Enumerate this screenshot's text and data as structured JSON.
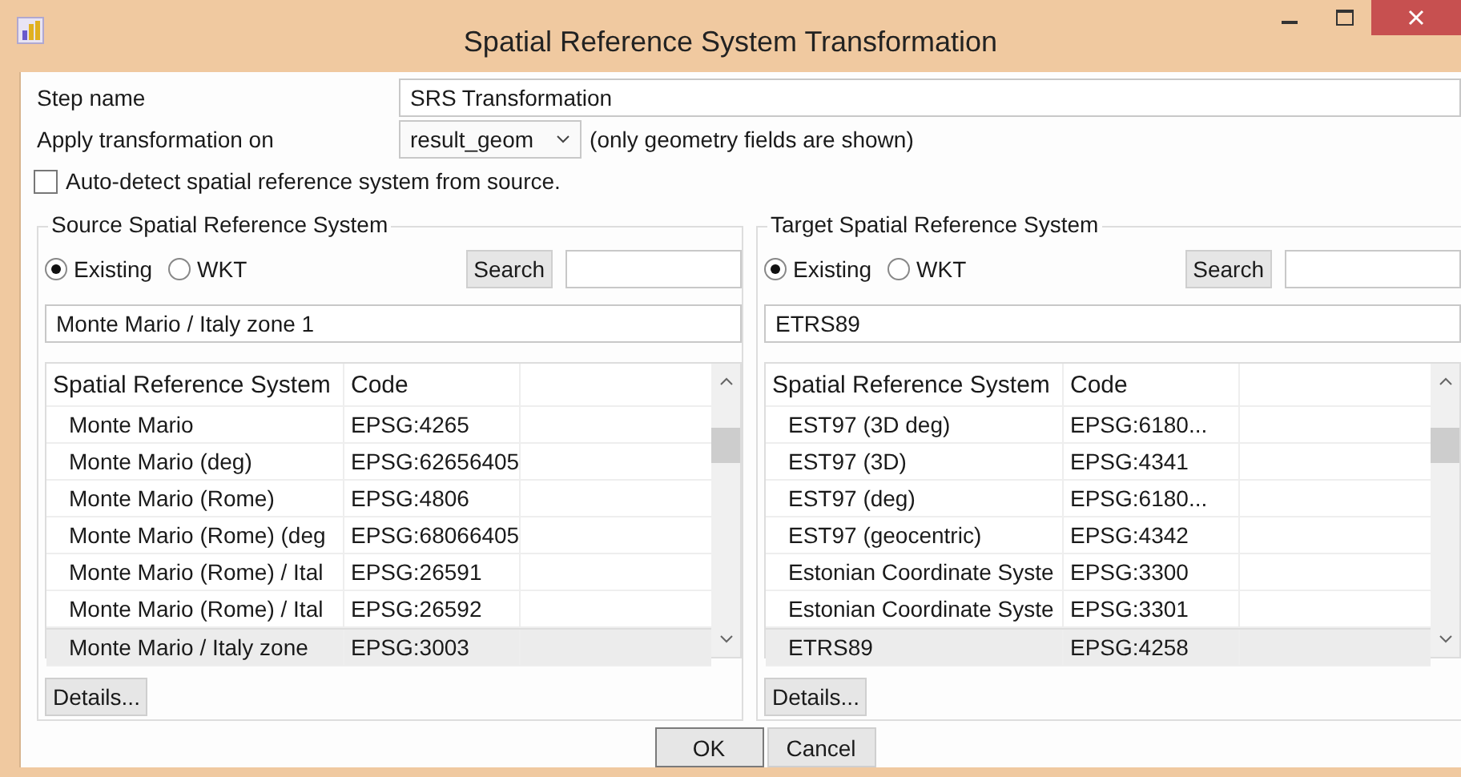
{
  "window": {
    "title": "Spatial Reference System Transformation"
  },
  "step_name": {
    "label": "Step name",
    "value": "SRS Transformation"
  },
  "apply_on": {
    "label": "Apply transformation on",
    "value": "result_geom",
    "note": "(only geometry fields are shown)"
  },
  "auto_detect": {
    "label": "Auto-detect spatial reference system from source.",
    "checked": false
  },
  "panels": [
    {
      "title": "Source Spatial Reference System",
      "radios": [
        {
          "label": "Existing",
          "selected": true
        },
        {
          "label": "WKT",
          "selected": false
        }
      ],
      "search_button": "Search",
      "current": "Monte Mario / Italy zone 1",
      "columns": [
        "Spatial Reference System",
        "Code"
      ],
      "rows": [
        {
          "name": "Monte Mario",
          "code": "EPSG:4265",
          "selected": false
        },
        {
          "name": "Monte Mario (deg)",
          "code": "EPSG:62656405",
          "selected": false
        },
        {
          "name": "Monte Mario (Rome)",
          "code": "EPSG:4806",
          "selected": false
        },
        {
          "name": "Monte Mario (Rome) (deg",
          "code": "EPSG:68066405",
          "selected": false
        },
        {
          "name": "Monte Mario (Rome) / Ital",
          "code": "EPSG:26591",
          "selected": false
        },
        {
          "name": "Monte Mario (Rome) / Ital",
          "code": "EPSG:26592",
          "selected": false
        },
        {
          "name": "Monte Mario / Italy zone",
          "code": "EPSG:3003",
          "selected": true
        }
      ],
      "details_button": "Details..."
    },
    {
      "title": "Target Spatial Reference System",
      "radios": [
        {
          "label": "Existing",
          "selected": true
        },
        {
          "label": "WKT",
          "selected": false
        }
      ],
      "search_button": "Search",
      "current": "ETRS89",
      "columns": [
        "Spatial Reference System",
        "Code"
      ],
      "rows": [
        {
          "name": "EST97 (3D deg)",
          "code": "EPSG:6180...",
          "selected": false
        },
        {
          "name": "EST97 (3D)",
          "code": "EPSG:4341",
          "selected": false
        },
        {
          "name": "EST97 (deg)",
          "code": "EPSG:6180...",
          "selected": false
        },
        {
          "name": "EST97 (geocentric)",
          "code": "EPSG:4342",
          "selected": false
        },
        {
          "name": "Estonian Coordinate Syste",
          "code": "EPSG:3300",
          "selected": false
        },
        {
          "name": "Estonian Coordinate Syste",
          "code": "EPSG:3301",
          "selected": false
        },
        {
          "name": "ETRS89",
          "code": "EPSG:4258",
          "selected": true
        }
      ],
      "details_button": "Details..."
    }
  ],
  "buttons": [
    "OK",
    "Cancel"
  ]
}
